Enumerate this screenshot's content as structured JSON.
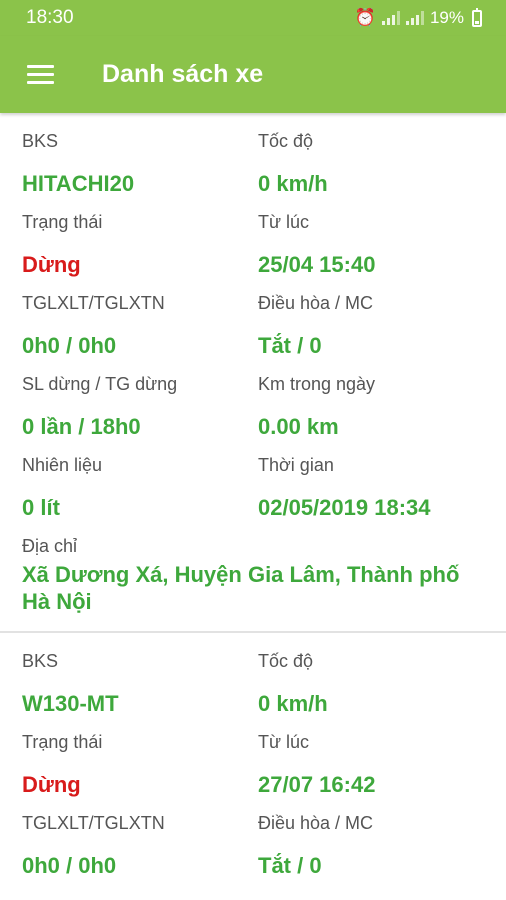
{
  "status_bar": {
    "time": "18:30",
    "battery": "19%",
    "icons": [
      "alarm-icon",
      "signal-icon",
      "4g-icon",
      "signal-icon",
      "battery-icon"
    ]
  },
  "app_bar": {
    "title": "Danh sách xe",
    "menu_icon": "hamburger-menu-icon"
  },
  "colors": {
    "primary": "#8bc34a",
    "value_green": "#3ea83c",
    "status_red": "#d81b1b",
    "label_gray": "#555555"
  },
  "labels": {
    "bks": "BKS",
    "toc_do": "Tốc độ",
    "trang_thai": "Trạng thái",
    "tu_luc": "Từ lúc",
    "tglxlt": "TGLXLT/TGLXTN",
    "dieu_hoa": "Điều hòa / MC",
    "sl_dung": "SL dừng / TG dừng",
    "km_ngay": "Km trong ngày",
    "nhien_lieu": "Nhiên liệu",
    "thoi_gian": "Thời gian",
    "dia_chi": "Địa chỉ"
  },
  "vehicles": [
    {
      "bks": "HITACHI20",
      "toc_do": "0 km/h",
      "trang_thai": "Dừng",
      "tu_luc": "25/04 15:40",
      "tglxlt": "0h0 / 0h0",
      "dieu_hoa": "Tắt / 0",
      "sl_dung": "0 lần / 18h0",
      "km_ngay": "0.00 km",
      "nhien_lieu": "0 lít",
      "thoi_gian": "02/05/2019 18:34",
      "dia_chi": "Xã Dương Xá, Huyện Gia Lâm, Thành phố Hà Nội"
    },
    {
      "bks": "W130-MT",
      "toc_do": "0 km/h",
      "trang_thai": "Dừng",
      "tu_luc": "27/07 16:42",
      "tglxlt": "0h0 / 0h0",
      "dieu_hoa": "Tắt / 0"
    }
  ]
}
